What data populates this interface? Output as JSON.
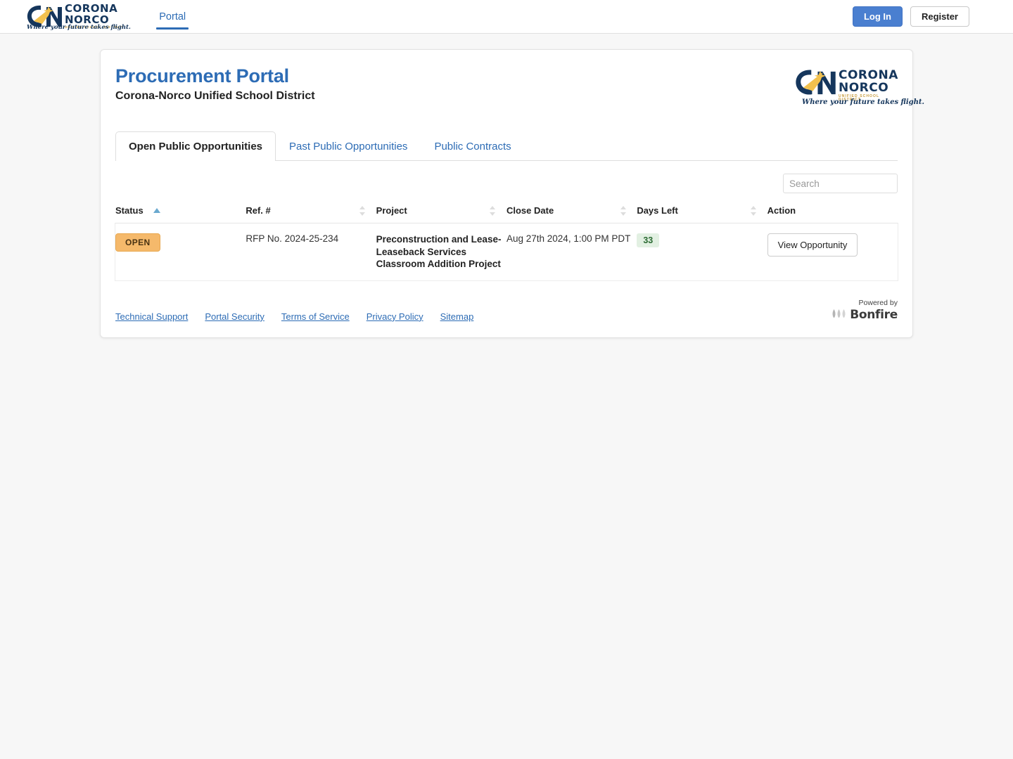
{
  "topbar": {
    "logo": {
      "line1": "CORONA",
      "line2": "NORCO",
      "sub": "UNIFIED SCHOOL DISTRICT",
      "tagline": "Where your future takes flight."
    },
    "nav": [
      {
        "label": "Portal",
        "active": true
      }
    ],
    "login_label": "Log In",
    "register_label": "Register"
  },
  "card": {
    "title": "Procurement Portal",
    "subtitle": "Corona-Norco Unified School District",
    "logo": {
      "line1": "CORONA",
      "line2": "NORCO",
      "sub": "UNIFIED SCHOOL DISTRICT",
      "tagline": "Where your future takes flight."
    }
  },
  "tabs": [
    {
      "label": "Open Public Opportunities",
      "active": true
    },
    {
      "label": "Past Public Opportunities",
      "active": false
    },
    {
      "label": "Public Contracts",
      "active": false
    }
  ],
  "search": {
    "placeholder": "Search",
    "value": ""
  },
  "table": {
    "columns": [
      {
        "label": "Status",
        "sort": "asc"
      },
      {
        "label": "Ref. #",
        "sort": "none"
      },
      {
        "label": "Project",
        "sort": "none"
      },
      {
        "label": "Close Date",
        "sort": "none"
      },
      {
        "label": "Days Left",
        "sort": "none"
      },
      {
        "label": "Action",
        "sort": "none"
      }
    ],
    "rows": [
      {
        "status": "OPEN",
        "ref": "RFP No. 2024-25-234",
        "project": "Preconstruction and Lease-Leaseback Services Classroom Addition Project",
        "close_date": "Aug 27th 2024, 1:00 PM PDT",
        "days_left": "33",
        "action": "View Opportunity"
      }
    ]
  },
  "footer": {
    "links": [
      {
        "label": "Technical Support"
      },
      {
        "label": "Portal Security"
      },
      {
        "label": "Terms of Service"
      },
      {
        "label": "Privacy Policy"
      },
      {
        "label": "Sitemap"
      }
    ],
    "powered_by_label": "Powered by",
    "powered_by_name": "Bonfire"
  },
  "colors": {
    "accent_blue": "#2d6cb5",
    "button_blue": "#4a7fd0",
    "status_open_bg": "#f5b96b",
    "days_badge_bg": "#e2f0e2",
    "days_badge_text": "#2b6b33",
    "logo_navy": "#15365c",
    "logo_gold": "#f2c14e"
  }
}
